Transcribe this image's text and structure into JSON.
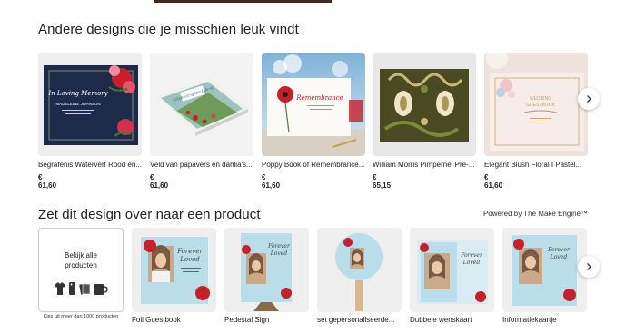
{
  "section1": {
    "title": "Andere designs die je misschien leuk vindt",
    "products": [
      {
        "name": "Begrafenis Waterverf Rood en...",
        "price": "€ 61,60"
      },
      {
        "name": "Veld van papavers en dahlia's...",
        "price": "€ 61,60"
      },
      {
        "name": "Poppy Book of Remembrance...",
        "price": "€ 61,60"
      },
      {
        "name": "William Morris Pimpernel Pre-...",
        "price": "€ 65,15"
      },
      {
        "name": "Elegant Blush Floral I Pastel...",
        "price": "€ 61,60"
      }
    ],
    "thumb_texts": {
      "p1_line1": "In Loving Memory",
      "p1_line2": "MADELEINE JOHNSON",
      "p2_line1": "Celebrating the Life of",
      "p3_line1": "Remembrance",
      "p5_line1": "WEDDING",
      "p5_line2": "GUESTBOOK"
    }
  },
  "section2": {
    "title": "Zet dit design over naar een product",
    "powered_by": "Powered by The Make Engine™",
    "browse": {
      "label": "Bekijk alle producten",
      "caption": "Kies uit meer dan 1000 producten"
    },
    "products": [
      {
        "name": "Foil Guestbook"
      },
      {
        "name": "Pedestal Sign"
      },
      {
        "name": "set gepersonaliseerde..."
      },
      {
        "name": "Dubbele wenskaart"
      },
      {
        "name": "Informatiekaartje"
      }
    ],
    "thumb_texts": {
      "forever": "Forever",
      "loved": "Loved"
    }
  },
  "colors": {
    "poppy_red": "#c8202a",
    "light_blue_card": "#b9dde9",
    "navy": "#1d2a4a"
  },
  "icons": [
    "chevron-right-icon",
    "tshirt-icon",
    "phone-case-icon",
    "cards-icon",
    "mug-icon"
  ]
}
